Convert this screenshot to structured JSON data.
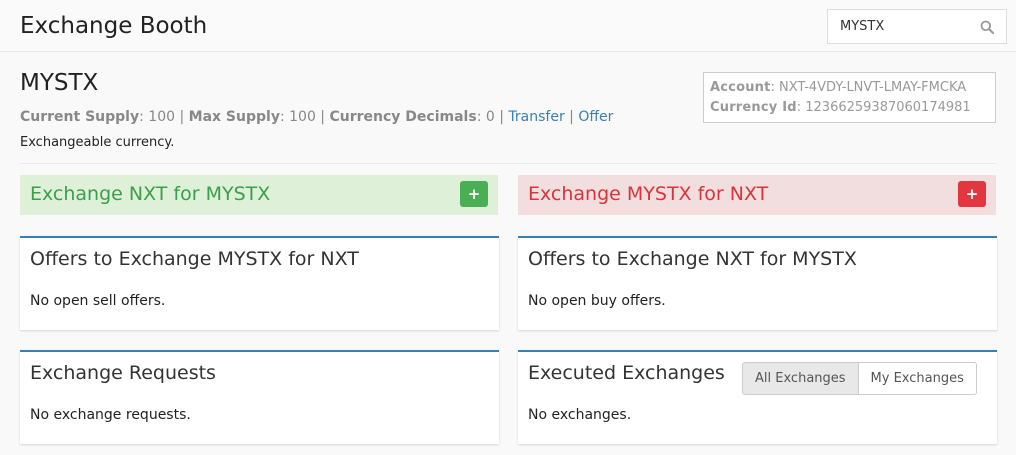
{
  "header": {
    "title": "Exchange Booth",
    "search_value": "MYSTX"
  },
  "currency": {
    "name": "MYSTX",
    "current_supply_label": "Current Supply",
    "current_supply_value": "100",
    "max_supply_label": "Max Supply",
    "max_supply_value": "100",
    "decimals_label": "Currency Decimals",
    "decimals_value": "0",
    "transfer_link": "Transfer",
    "offer_link": "Offer",
    "description": "Exchangeable currency."
  },
  "info": {
    "account_label": "Account",
    "account_value": "NXT-4VDY-LNVT-LMAY-FMCKA",
    "currency_id_label": "Currency Id",
    "currency_id_value": "12366259387060174981"
  },
  "exchange": {
    "buy_title": "Exchange NXT for MYSTX",
    "buy_button": "+",
    "sell_title": "Exchange MYSTX for NXT",
    "sell_button": "+"
  },
  "panels": {
    "sell_offers_title": "Offers to Exchange MYSTX for NXT",
    "sell_offers_empty": "No open sell offers.",
    "buy_offers_title": "Offers to Exchange NXT for MYSTX",
    "buy_offers_empty": "No open buy offers.",
    "requests_title": "Exchange Requests",
    "requests_empty": "No exchange requests.",
    "executed_title": "Executed Exchanges",
    "executed_empty": "No exchanges.",
    "tab_all": "All Exchanges",
    "tab_mine": "My Exchanges"
  },
  "icons": {
    "search": "search-icon"
  },
  "colors": {
    "link": "#3a7fb0",
    "buy_bg": "#dff0d8",
    "buy_text": "#3b9e4a",
    "sell_bg": "#f2dede",
    "sell_text": "#d9343a",
    "panel_border": "#3a7fb0"
  }
}
